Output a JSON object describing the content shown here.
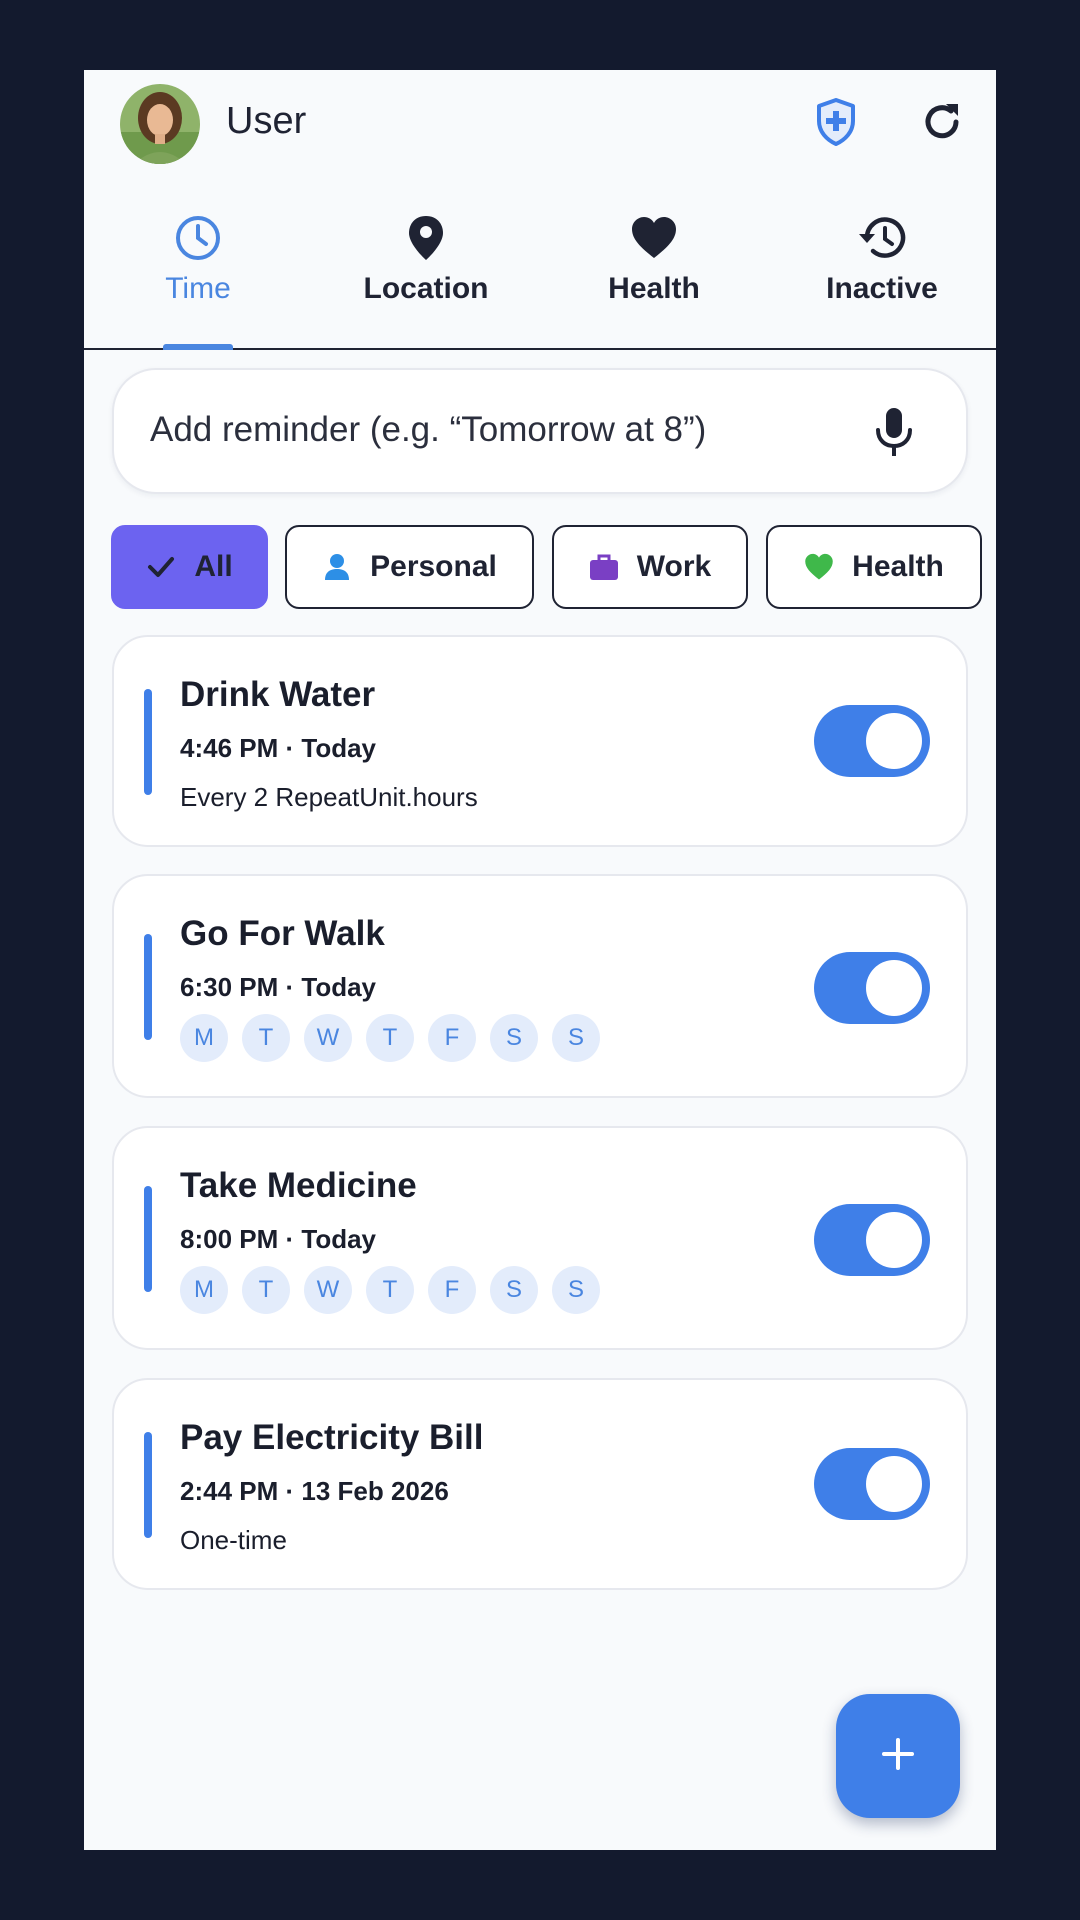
{
  "header": {
    "user_name": "User",
    "shield_icon": "shield-plus-icon",
    "refresh_icon": "refresh-icon"
  },
  "tabs": [
    {
      "label": "Time",
      "icon": "clock-icon",
      "active": true
    },
    {
      "label": "Location",
      "icon": "location-pin-icon",
      "active": false
    },
    {
      "label": "Health",
      "icon": "heart-icon",
      "active": false
    },
    {
      "label": "Inactive",
      "icon": "history-icon",
      "active": false
    }
  ],
  "search": {
    "placeholder": "Add reminder (e.g. “Tomorrow at 8”)",
    "icon": "microphone-icon"
  },
  "filters": [
    {
      "label": "All",
      "icon": "check-icon",
      "selected": true
    },
    {
      "label": "Personal",
      "icon": "person-icon",
      "selected": false
    },
    {
      "label": "Work",
      "icon": "briefcase-icon",
      "selected": false
    },
    {
      "label": "Health",
      "icon": "heart-icon",
      "selected": false
    }
  ],
  "reminders": [
    {
      "title": "Drink Water",
      "time": "4:46 PM · Today",
      "repeat": "Every 2 RepeatUnit.hours",
      "enabled": true
    },
    {
      "title": "Go For Walk",
      "time": "6:30 PM · Today",
      "days": [
        "M",
        "T",
        "W",
        "T",
        "F",
        "S",
        "S"
      ],
      "enabled": true
    },
    {
      "title": "Take Medicine",
      "time": "8:00 PM · Today",
      "days": [
        "M",
        "T",
        "W",
        "T",
        "F",
        "S",
        "S"
      ],
      "enabled": true
    },
    {
      "title": "Pay Electricity Bill",
      "time": "2:44 PM · 13 Feb 2026",
      "repeat": "One-time",
      "enabled": true
    }
  ],
  "fab": {
    "icon": "plus-icon"
  },
  "colors": {
    "accent": "#3f7fe8",
    "tab_active": "#4a86e0",
    "chip_selected": "#6c63f0",
    "background": "#f8fafc",
    "frame": "#131a2e"
  }
}
